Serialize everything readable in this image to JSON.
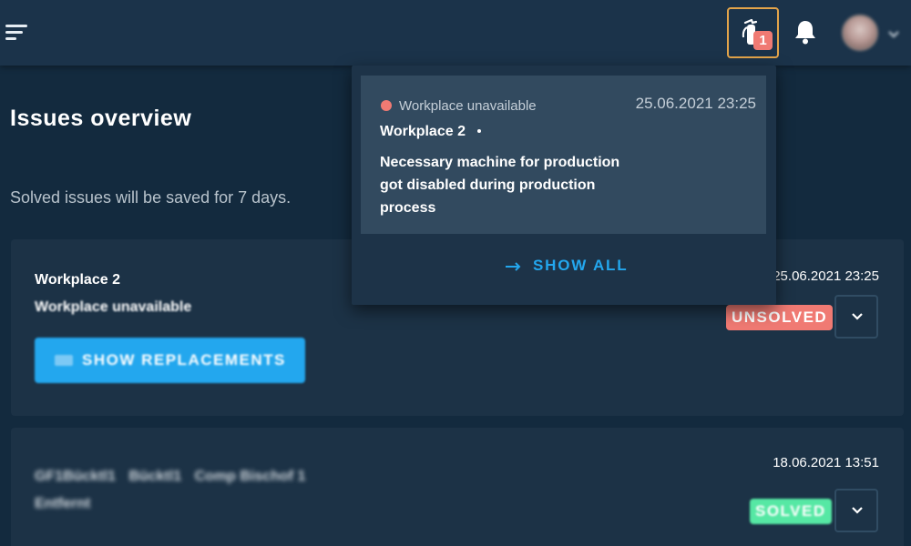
{
  "header": {
    "issues_count": "1"
  },
  "page": {
    "title": "Issues overview",
    "subtitle": "Solved issues will be saved for 7 days."
  },
  "issues": [
    {
      "title": "Workplace 2",
      "subtitle": "Workplace unavailable",
      "date": "25.06.2021 23:25",
      "status": "UNSOLVED",
      "action_label": "SHOW REPLACEMENTS"
    },
    {
      "title": "Comp Bischof 1",
      "title_prefix_a": "GF1Bücktl1",
      "title_prefix_b": "Bücktl1",
      "subtitle": "Entfernt",
      "date": "18.06.2021 13:51",
      "status": "SOLVED"
    }
  ],
  "notification_dropdown": {
    "item": {
      "status": "Workplace unavailable",
      "date": "25.06.2021 23:25",
      "title": "Workplace 2",
      "description": "Necessary machine for production got disabled during production process"
    },
    "show_all_label": "SHOW ALL"
  },
  "colors": {
    "accent": "#23a7ee",
    "unsolved": "#f07a73",
    "solved": "#56e8a4",
    "highlight_border": "#e3a44a"
  }
}
